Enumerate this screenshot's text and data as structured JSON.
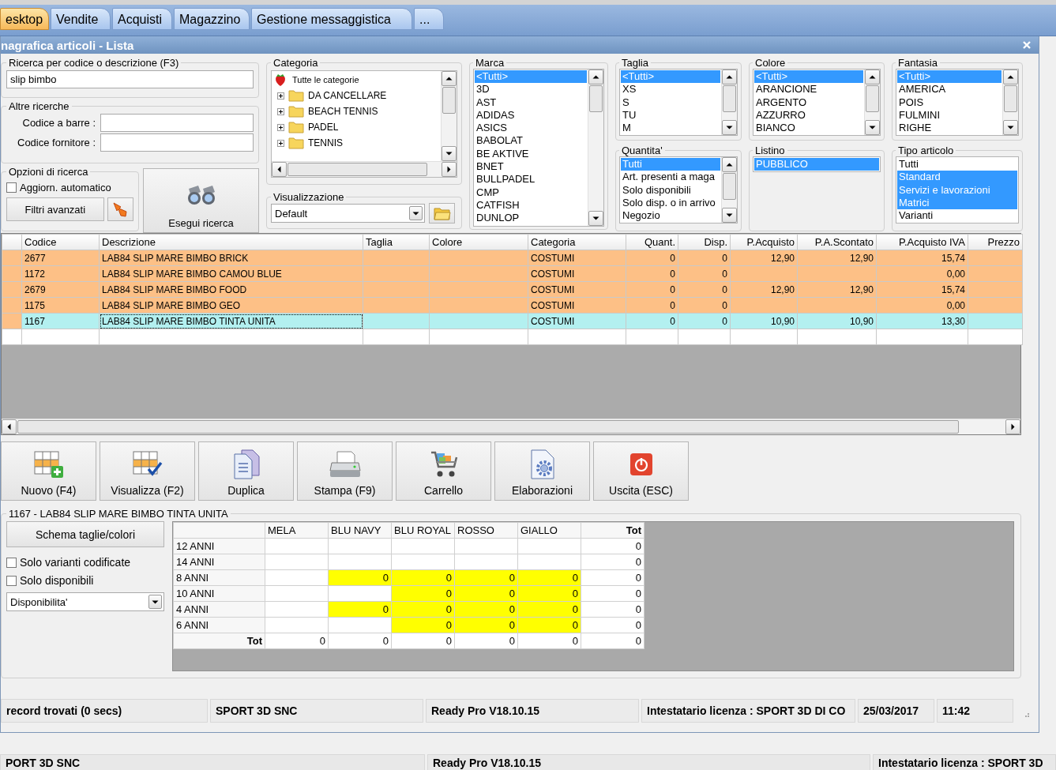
{
  "menu_tabs": [
    {
      "label": "esktop",
      "selected": true
    },
    {
      "label": "Vendite",
      "selected": false
    },
    {
      "label": "Acquisti",
      "selected": false
    },
    {
      "label": "Magazzino",
      "selected": false
    },
    {
      "label": "Gestione messaggistica",
      "selected": false
    },
    {
      "label": "...",
      "selected": false
    }
  ],
  "window": {
    "title": "nagrafica articoli  - Lista"
  },
  "search": {
    "legend": "Ricerca per codice o descrizione (F3)",
    "value": "slip bimbo"
  },
  "other_searches": {
    "legend": "Altre ricerche",
    "fields": [
      {
        "label": "Codice a barre :"
      },
      {
        "label": "Codice fornitore :"
      }
    ]
  },
  "search_options": {
    "legend": "Opzioni di ricerca",
    "auto_update": {
      "label": "Aggiorn. automatico",
      "checked": false
    },
    "advanced_filters": "Filtri avanzati"
  },
  "run_search": "Esegui ricerca",
  "category": {
    "legend": "Categoria",
    "root": "Tutte le categorie",
    "items": [
      {
        "label": "DA CANCELLARE",
        "expanded": false
      },
      {
        "label": "BEACH TENNIS",
        "expanded": false
      },
      {
        "label": "PADEL",
        "expanded": false
      },
      {
        "label": "TENNIS",
        "expanded": false
      }
    ]
  },
  "view": {
    "legend": "Visualizzazione",
    "value": "Default"
  },
  "lists": [
    {
      "legend": "Marca",
      "items": [
        {
          "label": "<Tutti>",
          "selected": true
        },
        {
          "label": "3D",
          "selected": false
        },
        {
          "label": "AST",
          "selected": false
        },
        {
          "label": "ADIDAS",
          "selected": false
        },
        {
          "label": "ASICS",
          "selected": false
        },
        {
          "label": "BABOLAT",
          "selected": false
        },
        {
          "label": "BE AKTIVE",
          "selected": false
        },
        {
          "label": "BNET",
          "selected": false
        },
        {
          "label": "BULLPADEL",
          "selected": false
        },
        {
          "label": "CMP",
          "selected": false
        },
        {
          "label": "CATFISH",
          "selected": false
        },
        {
          "label": "DUNLOP",
          "selected": false
        }
      ]
    },
    {
      "legend": "Taglia",
      "items": [
        {
          "label": "<Tutti>",
          "selected": true
        },
        {
          "label": "XS",
          "selected": false
        },
        {
          "label": "S",
          "selected": false
        },
        {
          "label": "TU",
          "selected": false
        },
        {
          "label": "M",
          "selected": false
        }
      ]
    },
    {
      "legend": "Quantita'",
      "items": [
        {
          "label": "Tutti",
          "selected": true
        },
        {
          "label": "Art. presenti a maga",
          "selected": false
        },
        {
          "label": "Solo disponibili",
          "selected": false
        },
        {
          "label": "Solo disp. o in arrivo",
          "selected": false
        },
        {
          "label": "Negozio",
          "selected": false
        }
      ]
    },
    {
      "legend": "Colore",
      "items": [
        {
          "label": "<Tutti>",
          "selected": true
        },
        {
          "label": "ARANCIONE",
          "selected": false
        },
        {
          "label": "ARGENTO",
          "selected": false
        },
        {
          "label": "AZZURRO",
          "selected": false
        },
        {
          "label": "BIANCO",
          "selected": false
        }
      ]
    },
    {
      "legend": "Listino",
      "items": [
        {
          "label": "PUBBLICO",
          "selected": true
        }
      ]
    },
    {
      "legend": "Fantasia",
      "items": [
        {
          "label": "<Tutti>",
          "selected": true
        },
        {
          "label": "AMERICA",
          "selected": false
        },
        {
          "label": "POIS",
          "selected": false
        },
        {
          "label": "FULMINI",
          "selected": false
        },
        {
          "label": "RIGHE",
          "selected": false
        }
      ]
    },
    {
      "legend": "Tipo articolo",
      "items": [
        {
          "label": "Tutti",
          "selected": false
        },
        {
          "label": "Standard",
          "selected": true
        },
        {
          "label": "Servizi e lavorazioni",
          "selected": true
        },
        {
          "label": "Matrici",
          "selected": true
        },
        {
          "label": "Varianti",
          "selected": false
        }
      ]
    }
  ],
  "table": {
    "columns": [
      "Codice",
      "Descrizione",
      "Taglia",
      "Colore",
      "Categoria",
      "Quant.",
      "Disp.",
      "P.Acquisto",
      "P.A.Scontato",
      "P.Acquisto IVA",
      "Prezzo"
    ],
    "rows": [
      {
        "selected": false,
        "cells": [
          {
            "text": "2677"
          },
          {
            "text": "LAB84 SLIP MARE BIMBO BRICK"
          },
          {},
          {},
          {
            "text": "COSTUMI"
          },
          {
            "text": "0"
          },
          {
            "text": "0"
          },
          {
            "text": "12,90"
          },
          {
            "text": "12,90"
          },
          {
            "text": "15,74"
          },
          {}
        ]
      },
      {
        "selected": false,
        "cells": [
          {
            "text": "1172"
          },
          {
            "text": "LAB84 SLIP MARE BIMBO CAMOU BLUE"
          },
          {},
          {},
          {
            "text": "COSTUMI"
          },
          {
            "text": "0"
          },
          {
            "text": "0"
          },
          {},
          {},
          {
            "text": "0,00"
          },
          {}
        ]
      },
      {
        "selected": false,
        "cells": [
          {
            "text": "2679"
          },
          {
            "text": "LAB84 SLIP MARE BIMBO FOOD"
          },
          {},
          {},
          {
            "text": "COSTUMI"
          },
          {
            "text": "0"
          },
          {
            "text": "0"
          },
          {
            "text": "12,90"
          },
          {
            "text": "12,90"
          },
          {
            "text": "15,74"
          },
          {}
        ]
      },
      {
        "selected": false,
        "cells": [
          {
            "text": "1175"
          },
          {
            "text": "LAB84 SLIP MARE BIMBO GEO"
          },
          {},
          {},
          {
            "text": "COSTUMI"
          },
          {
            "text": "0"
          },
          {
            "text": "0"
          },
          {},
          {},
          {
            "text": "0,00"
          },
          {}
        ]
      },
      {
        "selected": true,
        "cells": [
          {
            "text": "1167"
          },
          {
            "text": "LAB84 SLIP MARE BIMBO TINTA UNITA"
          },
          {},
          {},
          {
            "text": "COSTUMI"
          },
          {
            "text": "0"
          },
          {
            "text": "0"
          },
          {
            "text": "10,90"
          },
          {
            "text": "10,90"
          },
          {
            "text": "13,30"
          },
          {}
        ]
      }
    ]
  },
  "actions": [
    {
      "kind": "new",
      "label": "Nuovo (F4)"
    },
    {
      "kind": "view",
      "label": "Visualizza (F2)"
    },
    {
      "kind": "duplicate",
      "label": "Duplica"
    },
    {
      "kind": "print",
      "label": "Stampa (F9)"
    },
    {
      "kind": "cart",
      "label": "Carrello"
    },
    {
      "kind": "process",
      "label": "Elaborazioni"
    },
    {
      "kind": "exit",
      "label": "Uscita (ESC)"
    }
  ],
  "variants": {
    "legend": "1167 - LAB84 SLIP MARE BIMBO TINTA UNITA",
    "scheme_button": "Schema taglie/colori",
    "options": [
      {
        "label": "Solo varianti codificate",
        "checked": false
      },
      {
        "label": "Solo disponibili",
        "checked": false
      }
    ],
    "mode": "Disponibilita'",
    "columns": [
      "MELA",
      "BLU NAVY",
      "BLU ROYAL",
      "ROSSO",
      "GIALLO"
    ],
    "total_label": "Tot",
    "rows": [
      {
        "label": "12 ANNI",
        "cells": [
          {
            "highlighted": false
          },
          {
            "highlighted": false
          },
          {
            "highlighted": false
          },
          {
            "highlighted": false
          },
          {
            "highlighted": false
          }
        ],
        "total": "0"
      },
      {
        "label": "14 ANNI",
        "cells": [
          {
            "highlighted": false
          },
          {
            "highlighted": false
          },
          {
            "highlighted": false
          },
          {
            "highlighted": false
          },
          {
            "highlighted": false
          }
        ],
        "total": "0"
      },
      {
        "label": "8 ANNI",
        "cells": [
          {
            "highlighted": false
          },
          {
            "highlighted": true,
            "value": "0"
          },
          {
            "highlighted": true,
            "value": "0"
          },
          {
            "highlighted": true,
            "value": "0"
          },
          {
            "highlighted": true,
            "value": "0"
          }
        ],
        "total": "0"
      },
      {
        "label": "10 ANNI",
        "cells": [
          {
            "highlighted": false
          },
          {
            "highlighted": false
          },
          {
            "highlighted": true,
            "value": "0"
          },
          {
            "highlighted": true,
            "value": "0"
          },
          {
            "highlighted": true,
            "value": "0"
          }
        ],
        "total": "0"
      },
      {
        "label": "4 ANNI",
        "cells": [
          {
            "highlighted": false
          },
          {
            "highlighted": true,
            "value": "0"
          },
          {
            "highlighted": true,
            "value": "0"
          },
          {
            "highlighted": true,
            "value": "0"
          },
          {
            "highlighted": true,
            "value": "0"
          }
        ],
        "total": "0"
      },
      {
        "label": "6 ANNI",
        "cells": [
          {
            "highlighted": false
          },
          {
            "highlighted": false
          },
          {
            "highlighted": true,
            "value": "0"
          },
          {
            "highlighted": true,
            "value": "0"
          },
          {
            "highlighted": true,
            "value": "0"
          }
        ],
        "total": "0"
      }
    ],
    "totals": {
      "label": "Tot",
      "values": [
        "0",
        "0",
        "0",
        "0",
        "0"
      ],
      "total": "0"
    }
  },
  "status_bar": [
    "record trovati (0 secs)",
    "SPORT 3D SNC",
    "Ready Pro V18.10.15",
    "Intestatario licenza : SPORT 3D DI CO",
    "25/03/2017",
    "11:42"
  ],
  "outer_status_bar": [
    "PORT 3D SNC",
    "Ready Pro V18.10.15",
    "Intestatario licenza : SPORT 3D"
  ]
}
